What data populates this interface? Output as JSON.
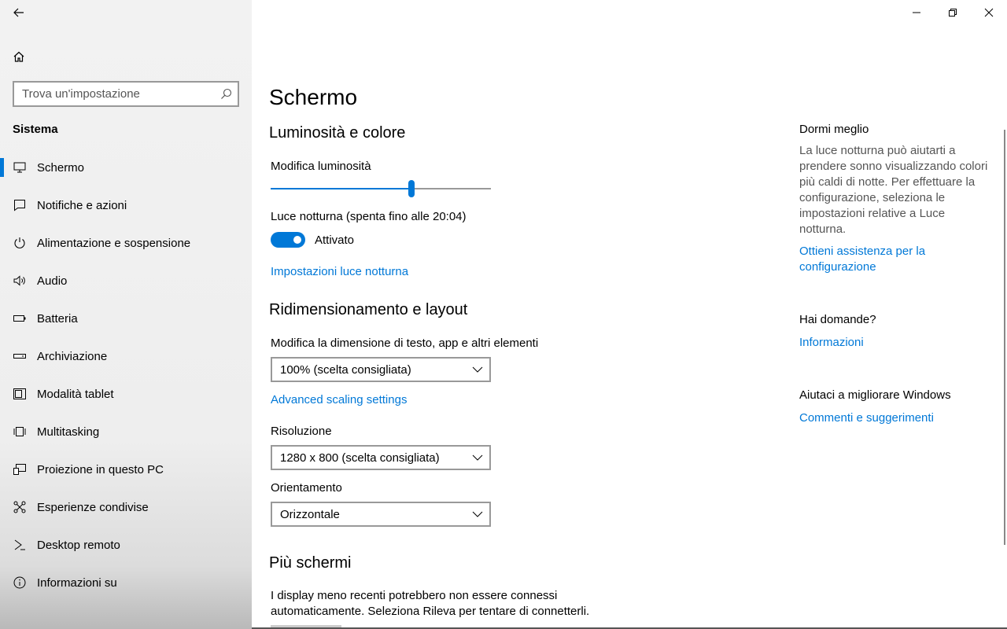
{
  "sidebar": {
    "search_placeholder": "Trova un'impostazione",
    "section_title": "Sistema",
    "items": [
      {
        "label": "Schermo",
        "icon": "monitor-icon"
      },
      {
        "label": "Notifiche e azioni",
        "icon": "message-icon"
      },
      {
        "label": "Alimentazione e sospensione",
        "icon": "power-icon"
      },
      {
        "label": "Audio",
        "icon": "speaker-icon"
      },
      {
        "label": "Batteria",
        "icon": "battery-icon"
      },
      {
        "label": "Archiviazione",
        "icon": "storage-icon"
      },
      {
        "label": "Modalità tablet",
        "icon": "tablet-icon"
      },
      {
        "label": "Multitasking",
        "icon": "multitasking-icon"
      },
      {
        "label": "Proiezione in questo PC",
        "icon": "projection-icon"
      },
      {
        "label": "Esperienze condivise",
        "icon": "shared-icon"
      },
      {
        "label": "Desktop remoto",
        "icon": "remote-icon"
      },
      {
        "label": "Informazioni su",
        "icon": "info-icon"
      }
    ]
  },
  "main": {
    "title": "Schermo",
    "brightness_section": {
      "heading": "Luminosità e colore",
      "brightness_label": "Modifica luminosità",
      "brightness_value": 0.64,
      "night_light_label": "Luce notturna (spenta fino alle 20:04)",
      "night_light_state": "Attivato",
      "night_light_settings_link": "Impostazioni luce notturna"
    },
    "scale_section": {
      "heading": "Ridimensionamento e layout",
      "scale_label": "Modifica la dimensione di testo, app e altri elementi",
      "scale_value": "100% (scelta consigliata)",
      "advanced_link": "Advanced scaling settings",
      "resolution_label": "Risoluzione",
      "resolution_value": "1280 x 800 (scelta consigliata)",
      "orientation_label": "Orientamento",
      "orientation_value": "Orizzontale"
    },
    "multi_section": {
      "heading": "Più schermi",
      "text": "I display meno recenti potrebbero non essere connessi automaticamente. Seleziona Rileva per tentare di connetterli."
    }
  },
  "right": {
    "sleep_heading": "Dormi meglio",
    "sleep_text": "La luce notturna può aiutarti a prendere sonno visualizzando colori più caldi di notte. Per effettuare la configurazione, seleziona le impostazioni relative a Luce notturna.",
    "sleep_link": "Ottieni assistenza per la configurazione",
    "questions_heading": "Hai domande?",
    "questions_link": "Informazioni",
    "improve_heading": "Aiutaci a migliorare Windows",
    "improve_link": "Commenti e suggerimenti"
  },
  "colors": {
    "accent": "#0078d7"
  }
}
